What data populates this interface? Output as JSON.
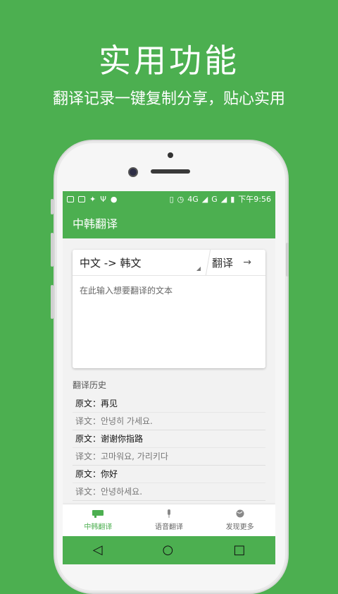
{
  "promo": {
    "title": "实用功能",
    "subtitle": "翻译记录一键复制分享，贴心实用"
  },
  "colors": {
    "brand": "#4caf50",
    "card": "#ffffff",
    "text_dark": "#222222",
    "text_muted": "#777777"
  },
  "statusbar": {
    "network_4g": "4G",
    "network_g": "G",
    "time": "下午9:56",
    "left_icons": [
      "voicemail-icon",
      "image-icon",
      "running-icon",
      "usb-icon",
      "android-icon"
    ],
    "right_icons": [
      "vibrate-icon",
      "alarm-icon",
      "signal-icon",
      "battery-icon"
    ]
  },
  "appbar": {
    "title": "中韩翻译"
  },
  "translator": {
    "language_pair": "中文 -> 韩文",
    "translate_label": "翻译",
    "arrow": "→",
    "input_placeholder": "在此输入想要翻译的文本"
  },
  "history": {
    "title": "翻译历史",
    "entries": [
      {
        "source": "原文：再见",
        "target": "译文：안녕히 가세요."
      },
      {
        "source": "原文：谢谢你指路",
        "target": "译文：고마워요, 가리키다"
      },
      {
        "source": "原文：你好",
        "target": "译文：안녕하세요."
      }
    ]
  },
  "bottom_nav": [
    {
      "label": "中韩翻译",
      "icon": "translate-icon",
      "active": true
    },
    {
      "label": "语音翻译",
      "icon": "microphone-icon",
      "active": false
    },
    {
      "label": "发现更多",
      "icon": "globe-icon",
      "active": false
    }
  ],
  "system_nav": {
    "back": "◁",
    "home": "○",
    "recents": "□"
  }
}
